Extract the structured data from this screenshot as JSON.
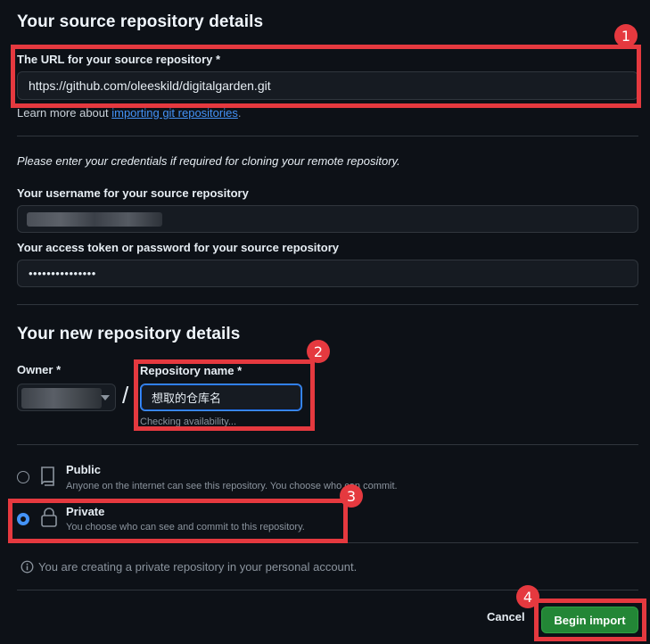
{
  "source": {
    "heading": "Your source repository details",
    "url_label": "The URL for your source repository *",
    "url_value": "https://github.com/oleeskild/digitalgarden.git",
    "learn_more_prefix": "Learn more about ",
    "learn_more_link": "importing git repositories",
    "learn_more_suffix": ".",
    "credentials_note": "Please enter your credentials if required for cloning your remote repository.",
    "username_label": "Your username for your source repository",
    "token_label": "Your access token or password for your source repository",
    "token_value": "•••••••••••••••"
  },
  "new_repo": {
    "heading": "Your new repository details",
    "owner_label": "Owner *",
    "slash": "/",
    "name_label": "Repository name *",
    "name_value": "想取的仓库名",
    "availability": "Checking availability..."
  },
  "visibility": {
    "options": [
      {
        "title": "Public",
        "desc": "Anyone on the internet can see this repository. You choose who can commit.",
        "selected": false
      },
      {
        "title": "Private",
        "desc": "You choose who can see and commit to this repository.",
        "selected": true
      }
    ],
    "info": "You are creating a private repository in your personal account."
  },
  "actions": {
    "cancel": "Cancel",
    "submit": "Begin import"
  },
  "annotations": [
    "1",
    "2",
    "3",
    "4"
  ],
  "icons": {
    "public": "repo-icon",
    "private": "lock-icon",
    "info": "info-icon",
    "owner_dropdown": "triangle-down-icon"
  },
  "colors": {
    "background": "#0d1117",
    "input_bg": "#161b22",
    "border": "#30363d",
    "link": "#4493f8",
    "primary_button": "#238636",
    "annotation_red": "#e5393f"
  }
}
